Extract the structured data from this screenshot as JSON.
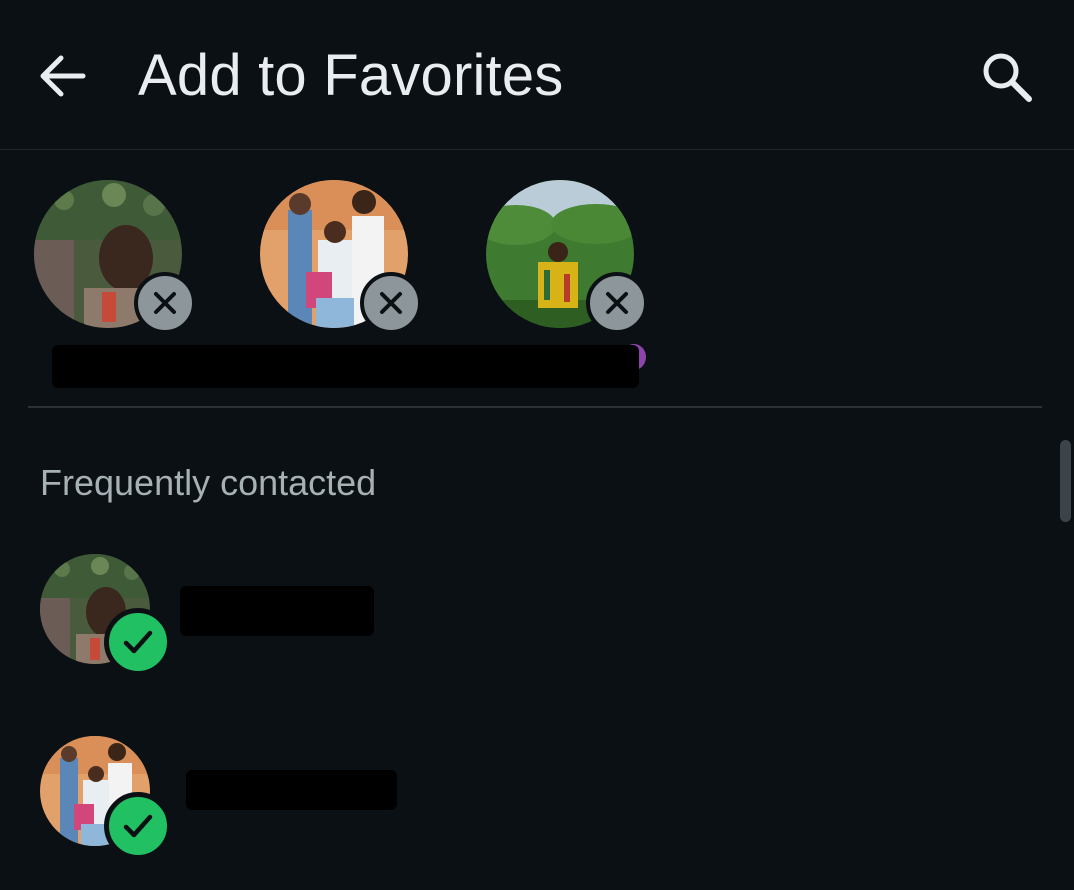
{
  "header": {
    "title": "Add to Favorites",
    "back_icon": "arrow-left-icon",
    "search_icon": "search-icon"
  },
  "selected": [
    {
      "avatar": "photo-avatar",
      "action_icon": "close-icon"
    },
    {
      "avatar": "photo-avatar",
      "action_icon": "close-icon"
    },
    {
      "avatar": "photo-avatar",
      "action_icon": "close-icon"
    }
  ],
  "section": {
    "title": "Frequently contacted"
  },
  "contacts": [
    {
      "avatar": "photo-avatar",
      "status_icon": "check-icon",
      "selected": true
    },
    {
      "avatar": "photo-avatar",
      "status_icon": "check-icon",
      "selected": true
    }
  ],
  "colors": {
    "background": "#0b1014",
    "primary_text": "#e9edef",
    "secondary_text": "#a7b0b5",
    "accent_green": "#21c063",
    "remove_badge": "#8d969b"
  }
}
